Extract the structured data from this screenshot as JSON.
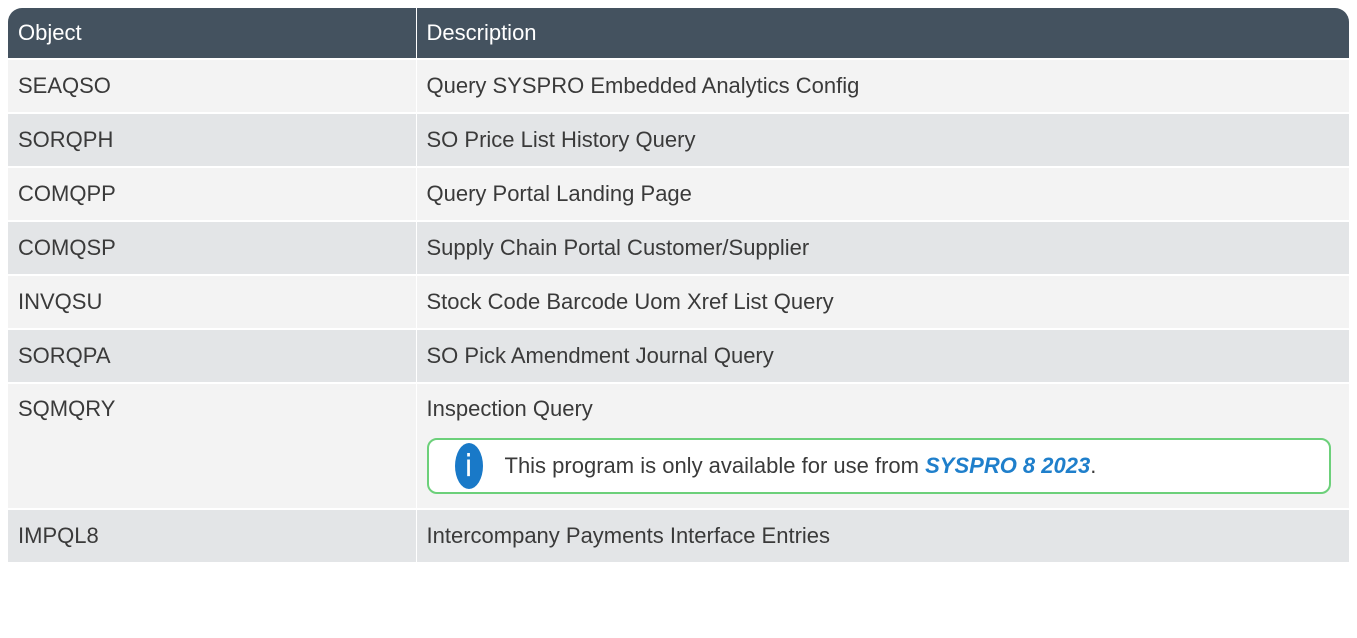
{
  "header": {
    "object": "Object",
    "description": "Description"
  },
  "rows": [
    {
      "object": "SEAQSO",
      "description": "Query SYSPRO Embedded Analytics Config"
    },
    {
      "object": "SORQPH",
      "description": "SO Price List History Query"
    },
    {
      "object": "COMQPP",
      "description": "Query Portal Landing Page"
    },
    {
      "object": "COMQSP",
      "description": "Supply Chain Portal Customer/Supplier"
    },
    {
      "object": "INVQSU",
      "description": "Stock Code Barcode Uom Xref List Query"
    },
    {
      "object": "SORQPA",
      "description": "SO Pick Amendment Journal Query"
    },
    {
      "object": "SQMQRY",
      "description": "Inspection Query"
    },
    {
      "object": "IMPQL8",
      "description": "Intercompany Payments Interface Entries"
    }
  ],
  "note": {
    "icon": "info-icon",
    "text_before": "This program is only available for use from ",
    "link": "SYSPRO 8 2023",
    "text_after": "."
  },
  "colors": {
    "header_bg": "#44525f",
    "row_light": "#f3f3f3",
    "row_dark": "#e3e5e7",
    "note_border": "#6cd07a",
    "icon_bg": "#1979c8",
    "link": "#1f7fcb"
  }
}
